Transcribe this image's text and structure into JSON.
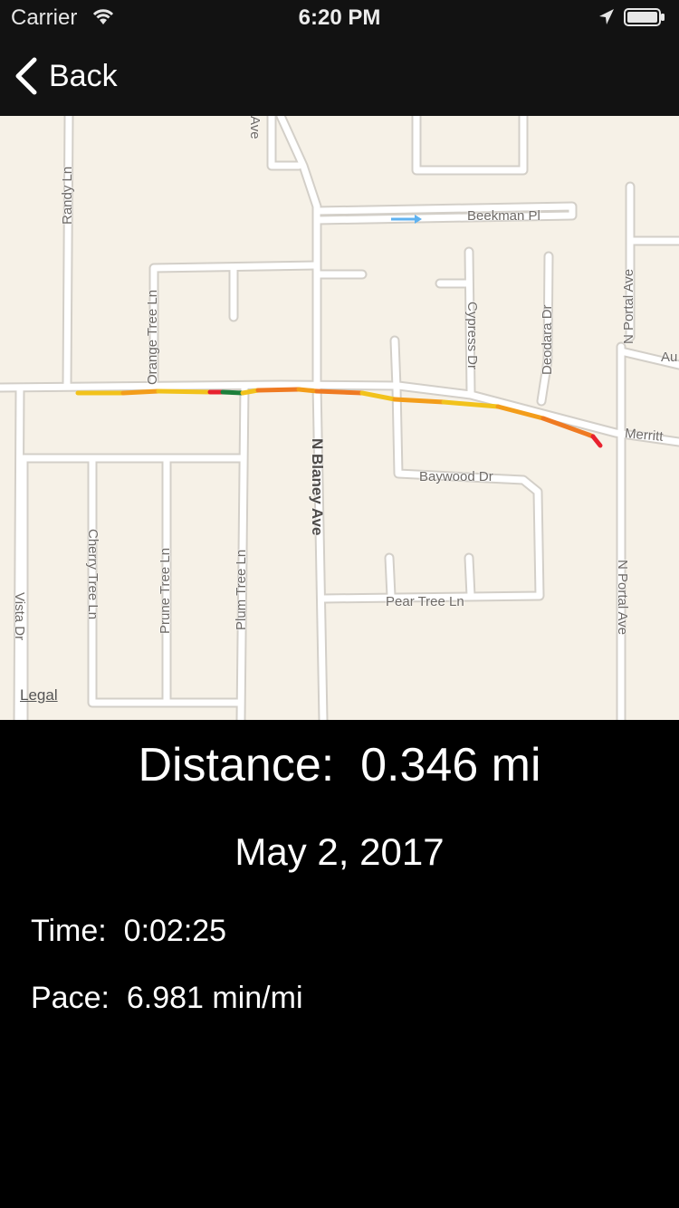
{
  "status_bar": {
    "carrier": "Carrier",
    "time": "6:20 PM"
  },
  "nav": {
    "back_label": "Back"
  },
  "map": {
    "streets": {
      "randy": "Randy Ln",
      "orange_tree": "Orange Tree Ln",
      "beekman": "Beekman Pl",
      "cypress": "Cypress Dr",
      "deodara": "Deodara Dr",
      "n_portal_top": "N Portal Ave",
      "au": "Au",
      "merritt": "Merritt",
      "n_blaney": "N Blaney Ave",
      "baywood": "Baywood Dr",
      "cherry_tree": "Cherry Tree Ln",
      "prune_tree": "Prune Tree Ln",
      "plum_tree": "Plum Tree Ln",
      "vista": "Vista Dr",
      "pear_tree": "Pear Tree Ln",
      "n_portal_bottom": "N Portal Ave",
      "ave_top": "Ave"
    },
    "legal": "Legal",
    "route_colors": [
      "#f2c21b",
      "#f39d1a",
      "#ef7a22",
      "#e8222f",
      "#1d7f3a"
    ]
  },
  "stats": {
    "distance_label": "Distance:",
    "distance_value": "0.346 mi",
    "date": "May 2, 2017",
    "time_label": "Time:",
    "time_value": "0:02:25",
    "pace_label": "Pace:",
    "pace_value": "6.981 min/mi"
  }
}
